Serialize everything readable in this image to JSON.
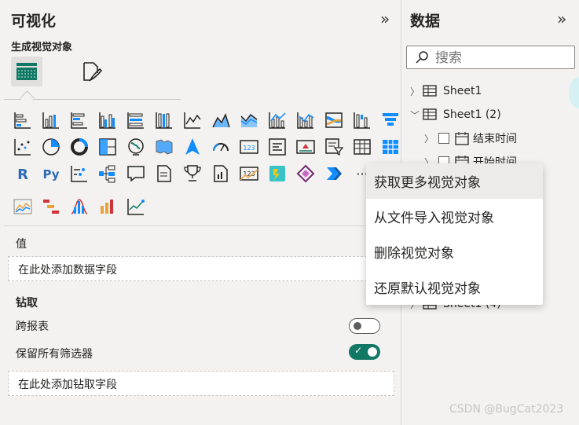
{
  "visualizations": {
    "title": "可视化",
    "build_label": "生成视觉对象",
    "more_icon": "···",
    "values_label": "值",
    "values_placeholder": "在此处添加数据字段",
    "drillthrough_label": "钻取",
    "cross_report_label": "跨报表",
    "cross_report_enabled": false,
    "keep_filters_label": "保留所有筛选器",
    "keep_filters_enabled": true,
    "drillthrough_placeholder": "在此处添加钻取字段"
  },
  "data_pane": {
    "title": "数据",
    "search_placeholder": "搜索",
    "tables": [
      {
        "name": "Sheet1",
        "expanded": false
      },
      {
        "name": "Sheet1 (2)",
        "expanded": true,
        "fields": [
          "结束时间",
          "开始时间"
        ]
      },
      {
        "name": "Sheet1 (4)",
        "expanded": false
      }
    ]
  },
  "context_menu": {
    "items": [
      "获取更多视觉对象",
      "从文件导入视觉对象",
      "删除视觉对象",
      "还原默认视觉对象"
    ]
  },
  "watermark": "CSDN @BugCat2023",
  "colors": {
    "accent": "#118dff",
    "toggle_on": "#117865",
    "teal": "#3ac2c9"
  }
}
